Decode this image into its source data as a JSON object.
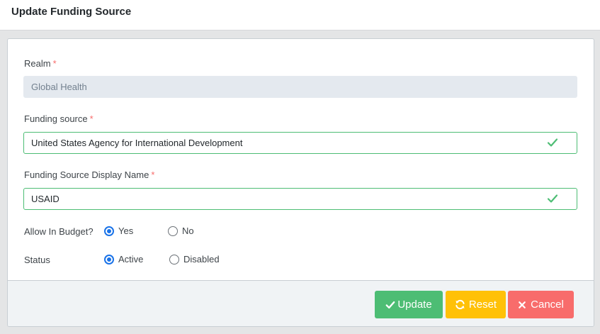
{
  "header": {
    "title": "Update Funding Source"
  },
  "form": {
    "realm": {
      "label": "Realm",
      "required": "*",
      "value": "Global Health"
    },
    "funding_source": {
      "label": "Funding source",
      "required": "*",
      "value": "United States Agency for International Development"
    },
    "display_name": {
      "label": "Funding Source Display Name",
      "required": "*",
      "value": "USAID"
    },
    "allow_in_budget": {
      "label": "Allow In Budget?",
      "options": [
        "Yes",
        "No"
      ],
      "selected": "Yes"
    },
    "status": {
      "label": "Status",
      "options": [
        "Active",
        "Disabled"
      ],
      "selected": "Active"
    }
  },
  "footer": {
    "update_label": "Update",
    "reset_label": "Reset",
    "cancel_label": "Cancel"
  },
  "icons": {
    "valid": "check-icon",
    "update": "check-icon",
    "reset": "refresh-icon",
    "cancel": "close-icon"
  },
  "colors": {
    "success": "#4dbd74",
    "warning": "#ffc107",
    "danger": "#f86c6b",
    "radio_accent": "#1a73e8"
  }
}
